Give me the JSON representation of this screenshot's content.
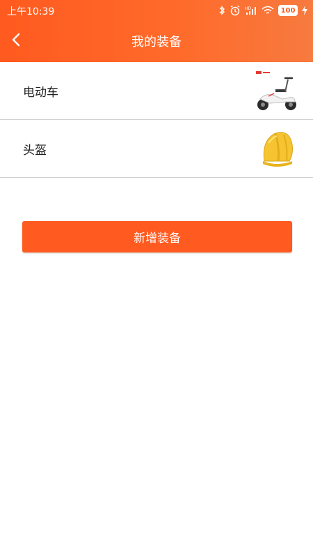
{
  "status_bar": {
    "time": "上午10:39",
    "battery": "100",
    "icons": [
      "bluetooth-icon",
      "alarm-icon",
      "signal-hd-icon",
      "wifi-icon",
      "battery-icon",
      "charging-icon"
    ]
  },
  "header": {
    "title": "我的装备",
    "back_icon": "chevron-left-icon",
    "gradient_colors": [
      "#ff5a1f",
      "#f77a3f"
    ]
  },
  "equipment": {
    "items": [
      {
        "label": "电动车",
        "image": "scooter-image"
      },
      {
        "label": "头盔",
        "image": "helmet-image"
      }
    ]
  },
  "actions": {
    "add_label": "新增装备",
    "accent": "#ff5a1f"
  }
}
